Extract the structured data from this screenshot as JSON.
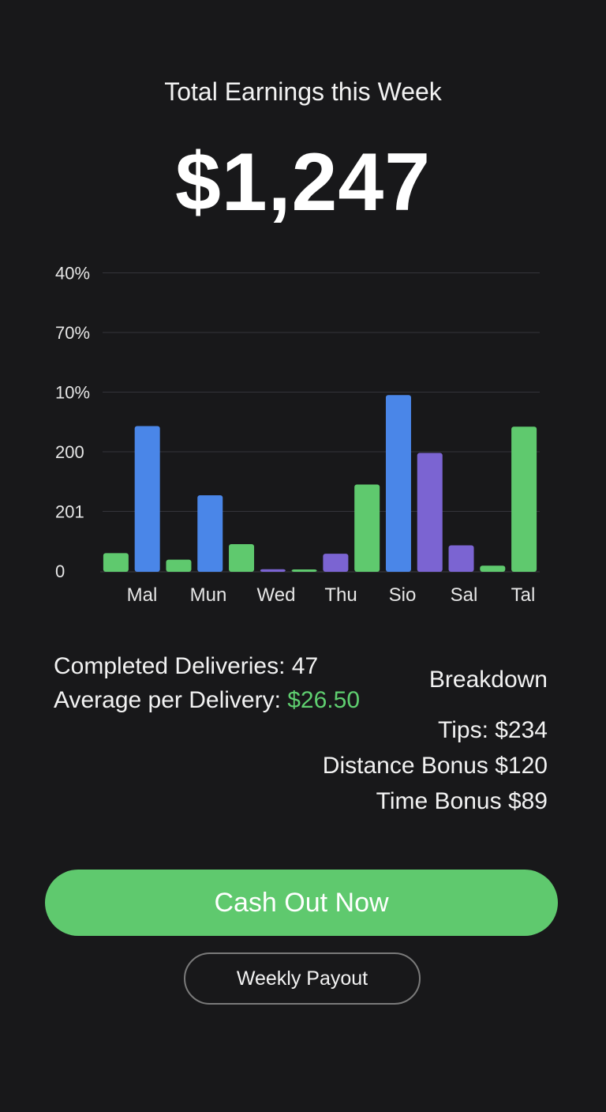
{
  "header": {
    "title": "Total Earnings this Week",
    "total": "$1,247"
  },
  "colors": {
    "green": "#5fc96e",
    "blue": "#4a86e8",
    "purple": "#7b64d2",
    "accent_text": "#5fcf70",
    "background": "#18181a"
  },
  "chart_data": {
    "type": "bar",
    "y_tick_labels": [
      "0",
      "201",
      "200",
      "10%",
      "70%",
      "40%"
    ],
    "x_tick_labels": [
      "Mal",
      "Mun",
      "Wed",
      "Thu",
      "Sio",
      "Sal",
      "Tal"
    ],
    "ylim": [
      0,
      5
    ],
    "grid": true,
    "bars": [
      {
        "color": "green",
        "value": 0.3
      },
      {
        "color": "blue",
        "value": 2.43
      },
      {
        "color": "green",
        "value": 0.19
      },
      {
        "color": "blue",
        "value": 1.27
      },
      {
        "color": "green",
        "value": 0.45
      },
      {
        "color": "purple",
        "value": 0.03
      },
      {
        "color": "green",
        "value": 0.02
      },
      {
        "color": "purple",
        "value": 0.29
      },
      {
        "color": "green",
        "value": 1.45
      },
      {
        "color": "blue",
        "value": 2.95
      },
      {
        "color": "purple",
        "value": 1.98
      },
      {
        "color": "purple",
        "value": 0.43
      },
      {
        "color": "green",
        "value": 0.09
      },
      {
        "color": "green",
        "value": 2.42
      }
    ]
  },
  "stats": {
    "completed_label": "Completed Deliveries: 47",
    "average_label": "Average per Delivery: ",
    "average_value": "$26.50"
  },
  "breakdown": {
    "title": "Breakdown",
    "tips": "Tips: $234",
    "distance_bonus": "Distance Bonus $120",
    "time_bonus": "Time Bonus $89"
  },
  "actions": {
    "cash_out_label": "Cash Out Now",
    "weekly_payout_label": "Weekly Payout"
  }
}
